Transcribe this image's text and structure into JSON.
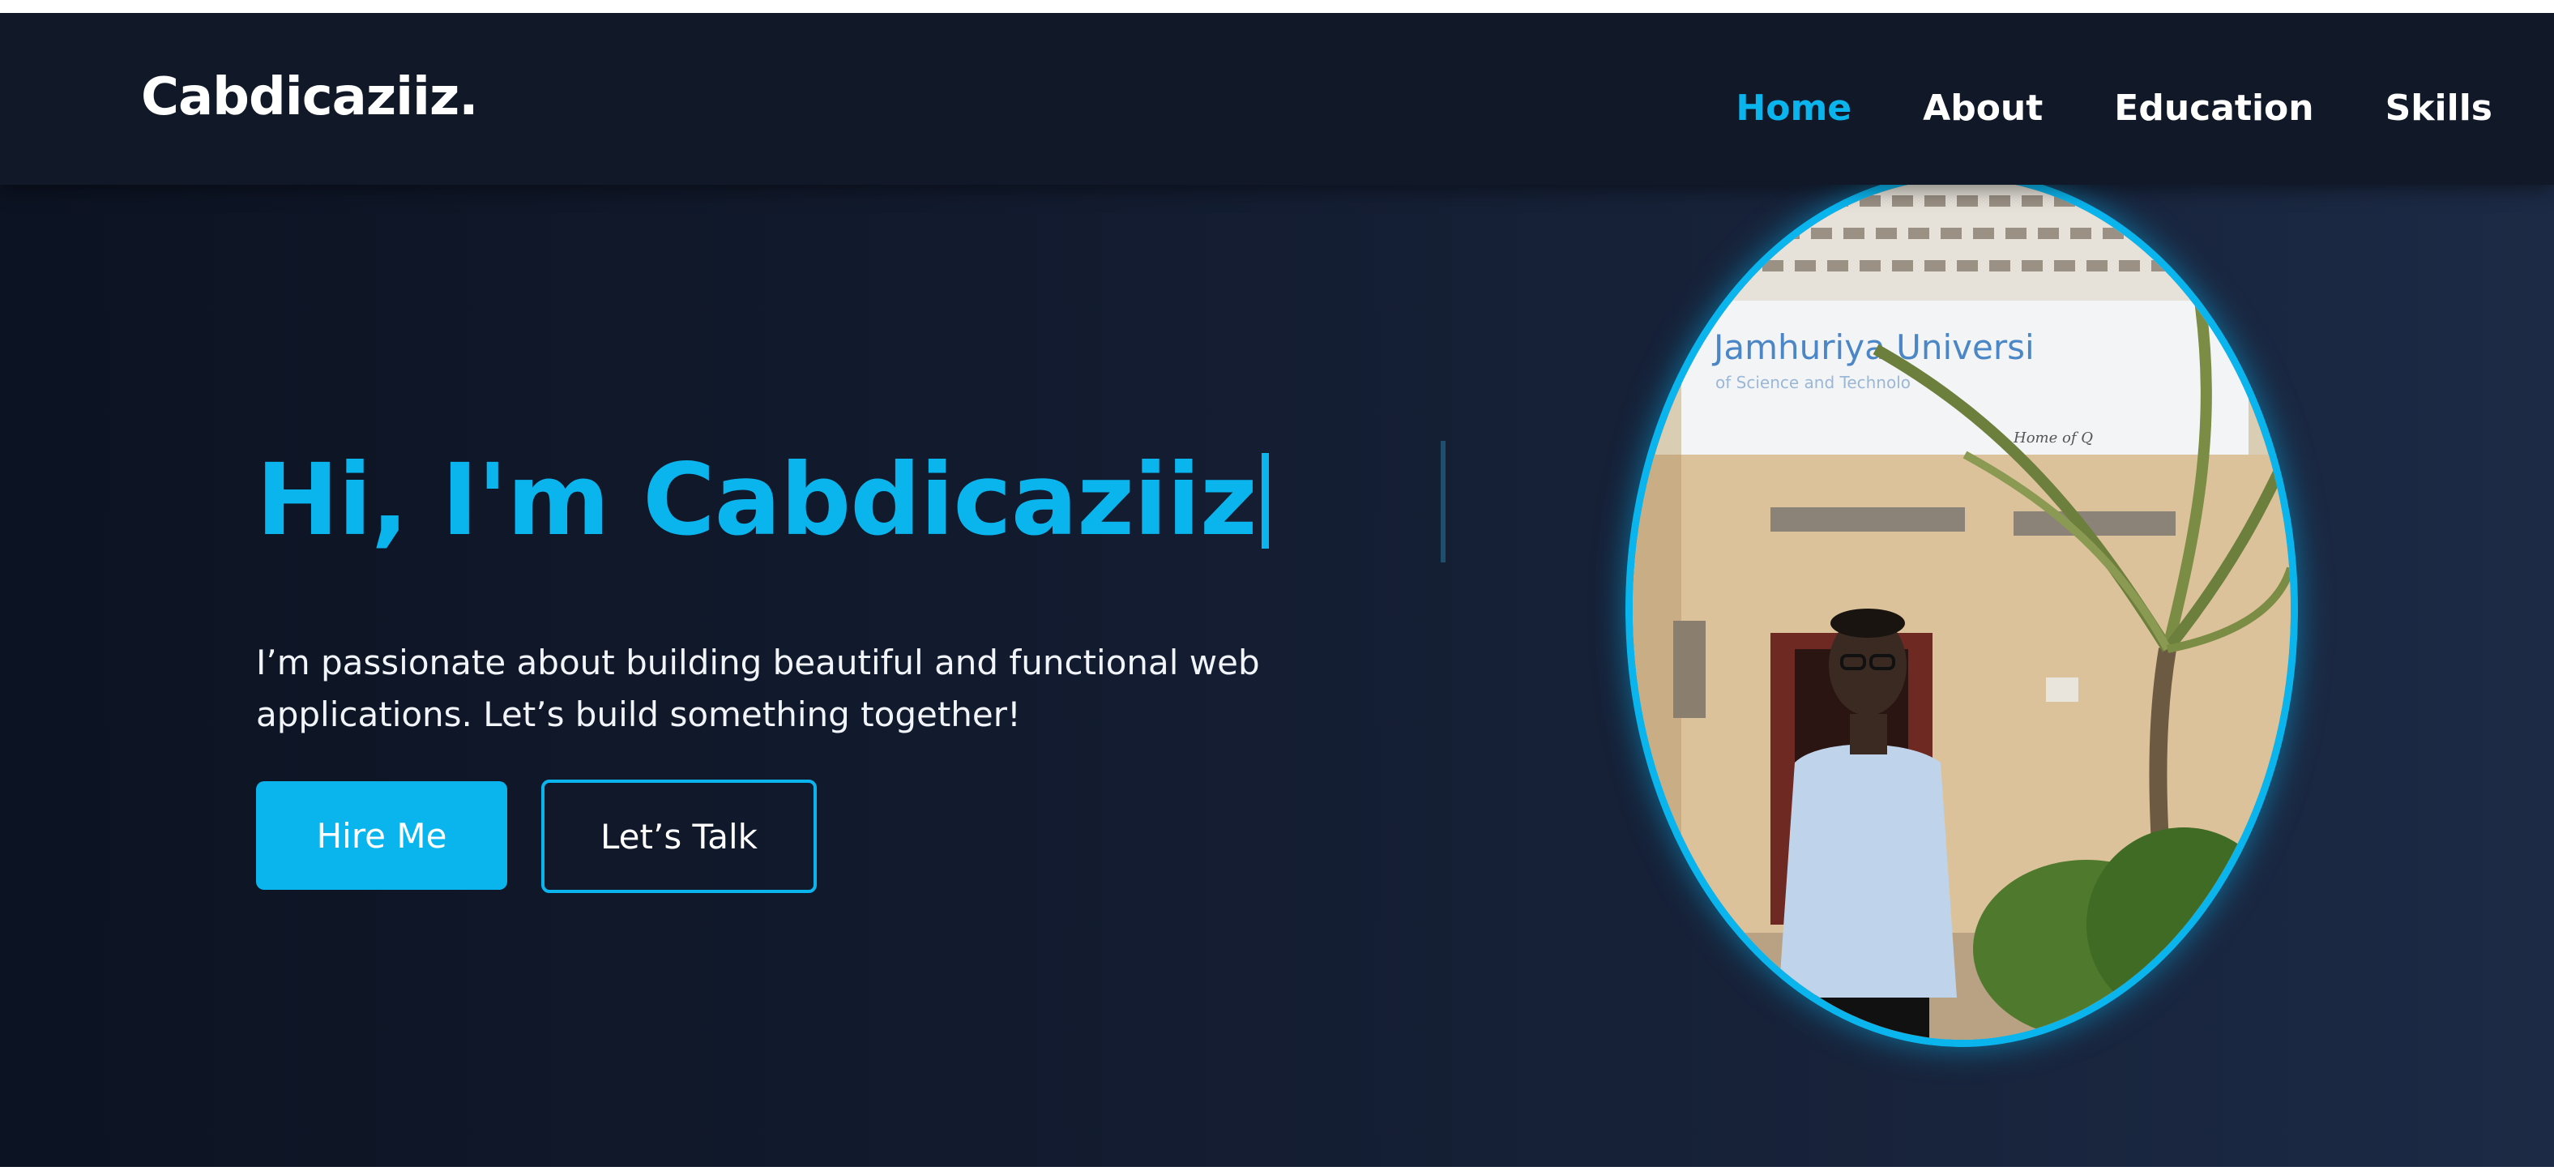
{
  "nav": {
    "logo": "Cabdicaziiz.",
    "links": [
      "Home",
      "About",
      "Education",
      "Skills"
    ],
    "active": "Home"
  },
  "hero": {
    "title": "Hi, I'm Cabdicaziiz",
    "description": "I’m passionate about building beautiful and functional web applications. Let’s build something together!",
    "primary_button": "Hire Me",
    "secondary_button": "Let’s Talk"
  },
  "photo": {
    "sign_text": "Jamhuriya Universi",
    "sign_subtext": "of Science and Technolo",
    "sign_motto": "Home of Q"
  },
  "colors": {
    "accent": "#0ab5ee",
    "navbar_bg": "#111827",
    "page_bg": "#131c30"
  }
}
